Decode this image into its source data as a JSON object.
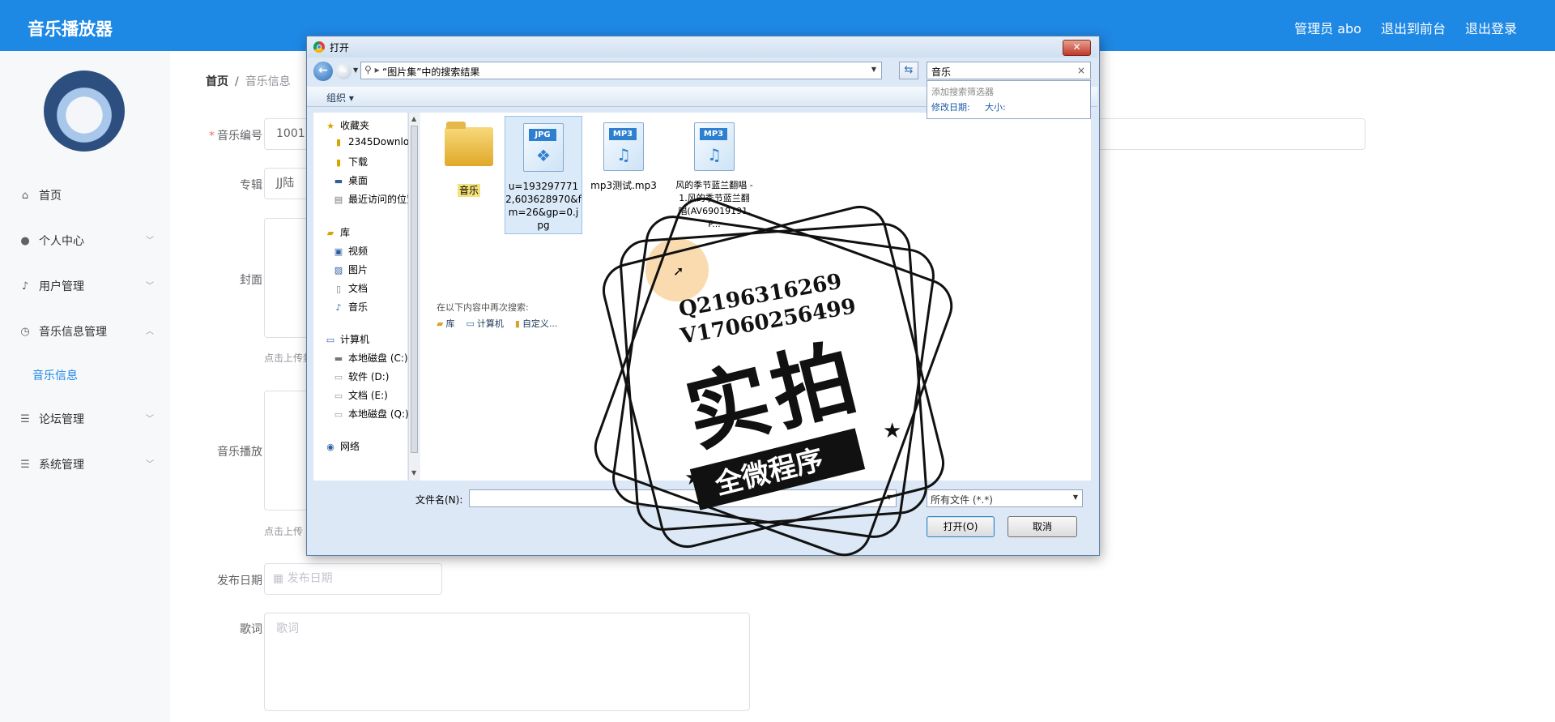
{
  "app": {
    "title": "音乐播放器",
    "top_links": [
      "管理员 abo",
      "退出到前台",
      "退出登录"
    ]
  },
  "sidebar": {
    "items": [
      {
        "icon": "home-icon",
        "label": "首页",
        "has_chevron": false
      },
      {
        "icon": "user-icon",
        "label": "个人中心",
        "has_chevron": true
      },
      {
        "icon": "mic-icon",
        "label": "用户管理",
        "has_chevron": true
      },
      {
        "icon": "clock-icon",
        "label": "音乐信息管理",
        "has_chevron": true,
        "expanded": true
      },
      {
        "icon": "list-icon",
        "label": "论坛管理",
        "has_chevron": true
      },
      {
        "icon": "list-icon",
        "label": "系统管理",
        "has_chevron": true
      }
    ],
    "sub_item": "音乐信息"
  },
  "breadcrumb": {
    "home": "首页",
    "sep": "/",
    "current": "音乐信息"
  },
  "form": {
    "fields": {
      "code": {
        "label": "音乐编号",
        "value": "1001",
        "required": true
      },
      "album": {
        "label": "专辑",
        "value": "JJ陆"
      },
      "cover": {
        "label": "封面",
        "hint": "点击上传封"
      },
      "play": {
        "label": "音乐播放",
        "hint": "点击上传"
      },
      "date": {
        "label": "发布日期",
        "placeholder": "发布日期"
      },
      "lyrics": {
        "label": "歌词",
        "placeholder": "歌词"
      }
    }
  },
  "dialog": {
    "title": "打开",
    "close_label": "✕",
    "address": "“图片集”中的搜索结果",
    "search_value": "音乐",
    "search_suggest": {
      "title": "添加搜索筛选器",
      "date": "修改日期:",
      "size": "大小:"
    },
    "organize": "组织 ▾",
    "tree": {
      "favorites_header": "收藏夹",
      "favorites": [
        "2345Downloads",
        "下载",
        "桌面",
        "最近访问的位置"
      ],
      "libraries_header": "库",
      "libraries": [
        "视频",
        "图片",
        "文档",
        "音乐"
      ],
      "computer_header": "计算机",
      "drives": [
        "本地磁盘 (C:)",
        "软件 (D:)",
        "文档 (E:)",
        "本地磁盘 (Q:)"
      ],
      "network": "网络"
    },
    "files": [
      {
        "name": "音乐",
        "type": "folder"
      },
      {
        "name": "u=1932977712,603628970&fm=26&gp=0.jpg",
        "type": "jpg",
        "tag": "JPG"
      },
      {
        "name": "mp3测试.mp3",
        "type": "mp3",
        "tag": "MP3"
      },
      {
        "name": "风的季节蓝兰翻唱 - 1.风的季节蓝兰翻唱(AV69019191,P...",
        "type": "mp3",
        "tag": "MP3"
      }
    ],
    "research_label": "在以下内容中再次搜索:",
    "research_links": [
      "库",
      "计算机",
      "自定义..."
    ],
    "filename_label": "文件名(N):",
    "filename_value": "",
    "filetype": "所有文件 (*.*)",
    "open_button": "打开(O)",
    "cancel_button": "取消"
  },
  "watermark": {
    "line1": "Q2196316269",
    "line2": "V17060256499",
    "big": "实拍",
    "banner": "全微程序"
  }
}
